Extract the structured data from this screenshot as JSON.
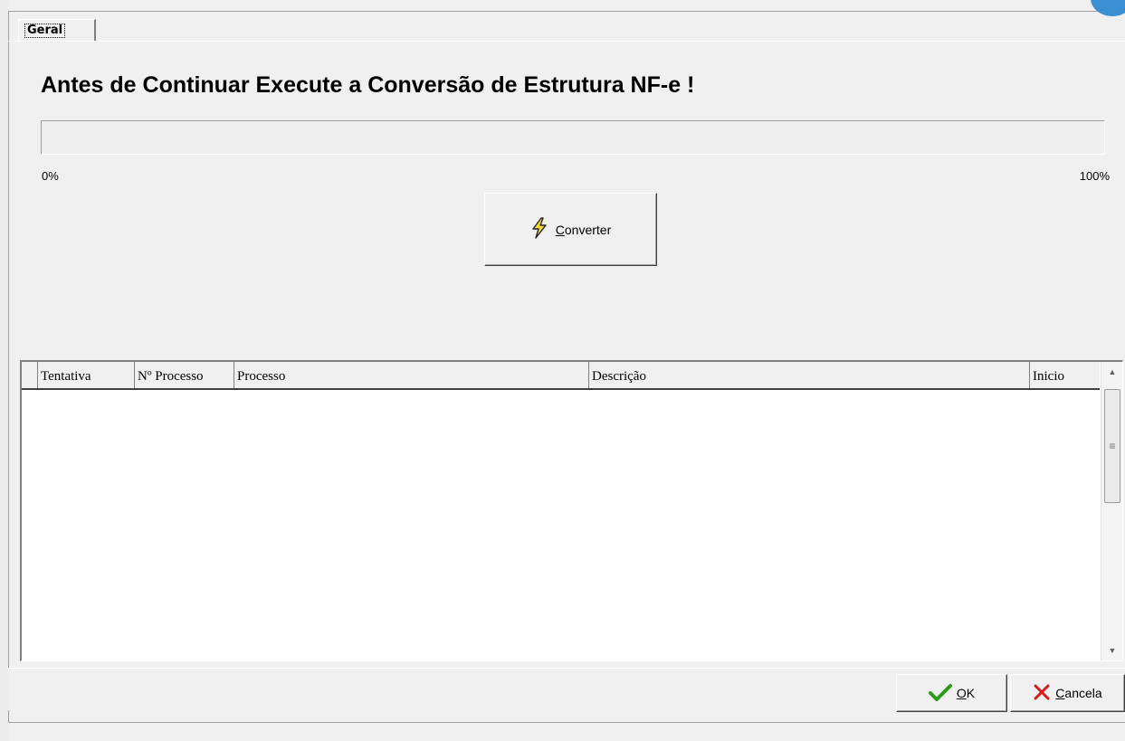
{
  "tab": {
    "label": "Geral"
  },
  "heading": "Antes de Continuar Execute a Conversão de Estrutura NF-e !",
  "progress": {
    "value": 0,
    "min_label": "0%",
    "max_label": "100%"
  },
  "convert_button": {
    "label": "Converter",
    "icon": "lightning-icon"
  },
  "table": {
    "columns": [
      "Tentativa",
      "Nº Processo",
      "Processo",
      "Descrição",
      "Inicio"
    ],
    "rows": []
  },
  "footer": {
    "ok_label": "OK",
    "cancel_label": "Cancela"
  },
  "colors": {
    "ok_check": "#2e9b1a",
    "cancel_x": "#d21e1e",
    "lightning": "#e0c020"
  }
}
